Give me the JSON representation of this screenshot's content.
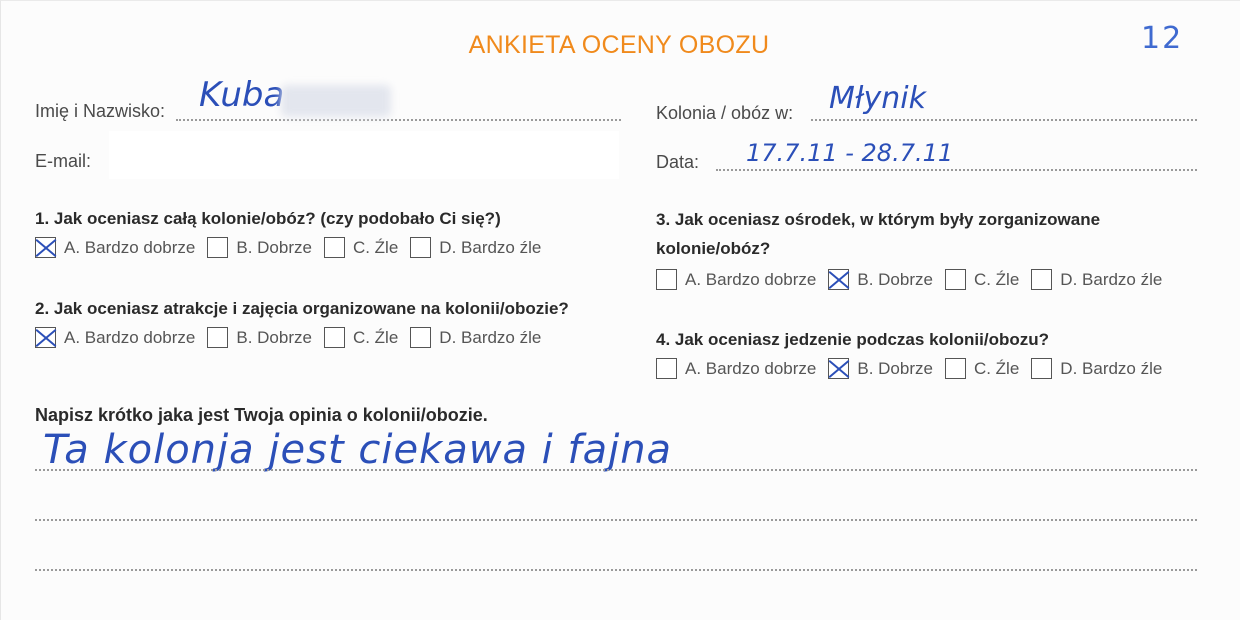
{
  "form": {
    "title": "ANKIETA OCENY OBOZU",
    "number": "12",
    "name_label": "Imię i Nazwisko:",
    "name_value": "Kuba",
    "email_label": "E-mail:",
    "camp_label": "Kolonia / obóz w:",
    "camp_value": "Młynik",
    "date_label": "Data:",
    "date_value": "17.7.11 - 28.7.11"
  },
  "questions": [
    {
      "text": "1. Jak oceniasz całą kolonie/obóz? (czy podobało Ci się?)",
      "options": [
        {
          "label": "A. Bardzo dobrze",
          "checked": true
        },
        {
          "label": "B. Dobrze",
          "checked": false
        },
        {
          "label": "C. Źle",
          "checked": false
        },
        {
          "label": "D. Bardzo źle",
          "checked": false
        }
      ]
    },
    {
      "text": "2.  Jak oceniasz atrakcje i zajęcia organizowane na kolonii/obozie?",
      "options": [
        {
          "label": "A. Bardzo dobrze",
          "checked": true
        },
        {
          "label": "B. Dobrze",
          "checked": false
        },
        {
          "label": "C. Źle",
          "checked": false
        },
        {
          "label": "D. Bardzo źle",
          "checked": false
        }
      ]
    },
    {
      "text_line1": "3. Jak oceniasz ośrodek, w którym były zorganizowane",
      "text_line2": "kolonie/obóz?",
      "options": [
        {
          "label": "A. Bardzo dobrze",
          "checked": false
        },
        {
          "label": "B. Dobrze",
          "checked": true
        },
        {
          "label": "C. Źle",
          "checked": false
        },
        {
          "label": "D. Bardzo źle",
          "checked": false
        }
      ]
    },
    {
      "text": "4.  Jak oceniasz jedzenie podczas kolonii/obozu?",
      "options": [
        {
          "label": "A. Bardzo dobrze",
          "checked": false
        },
        {
          "label": "B. Dobrze",
          "checked": true
        },
        {
          "label": "C. Źle",
          "checked": false
        },
        {
          "label": "D. Bardzo źle",
          "checked": false
        }
      ]
    }
  ],
  "opinion": {
    "prompt": "Napisz krótko jaka jest Twoja opinia o kolonii/obozie.",
    "answer": "Ta kolonja jest ciekawa i fajna"
  }
}
